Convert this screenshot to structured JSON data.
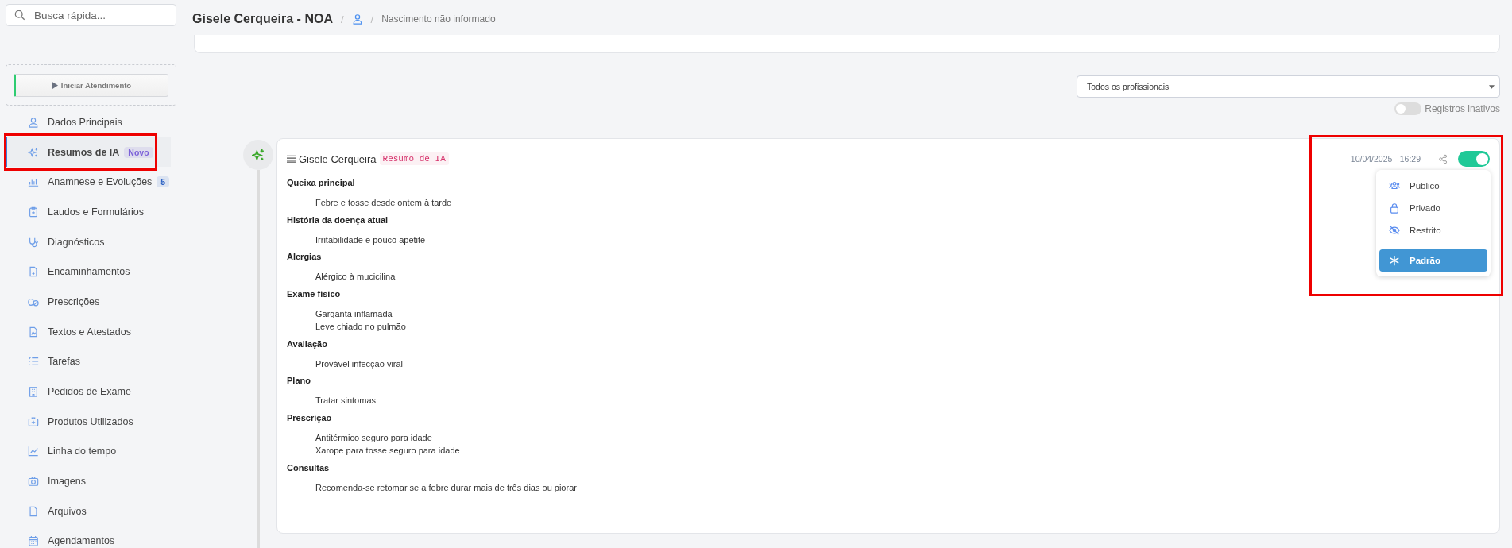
{
  "search": {
    "placeholder": "Busca rápida..."
  },
  "start_button": {
    "label": "Iniciar Atendimento"
  },
  "sidebar": {
    "items": [
      {
        "label": "Dados Principais",
        "selected": false
      },
      {
        "label": "Resumos de IA",
        "selected": true,
        "badge": "Novo",
        "color": "#7b61d8"
      },
      {
        "label": "Anamnese e Evoluções",
        "selected": false,
        "badge": "5",
        "color": "#2c62c4"
      },
      {
        "label": "Laudos e Formulários",
        "selected": false
      },
      {
        "label": "Diagnósticos",
        "selected": false
      },
      {
        "label": "Encaminhamentos",
        "selected": false
      },
      {
        "label": "Prescrições",
        "selected": false
      },
      {
        "label": "Textos e Atestados",
        "selected": false
      },
      {
        "label": "Tarefas",
        "selected": false
      },
      {
        "label": "Pedidos de Exame",
        "selected": false
      },
      {
        "label": "Produtos Utilizados",
        "selected": false
      },
      {
        "label": "Linha do tempo",
        "selected": false
      },
      {
        "label": "Imagens",
        "selected": false
      },
      {
        "label": "Arquivos",
        "selected": false
      },
      {
        "label": "Agendamentos",
        "selected": false
      }
    ]
  },
  "header": {
    "title": "Gisele Cerqueira - NOA",
    "separators": [
      "/",
      "/"
    ],
    "birth": "Nascimento não informado"
  },
  "filter": {
    "value": "Todos os profissionais"
  },
  "inactive_toggle": {
    "label": "Registros inativos",
    "on": false
  },
  "record": {
    "author": "Gisele Cerqueira",
    "tag": "Resumo de IA",
    "date": "10/04/2025 - 16:29",
    "active": true,
    "sections": [
      {
        "heading": "Queixa principal",
        "lines": [
          "Febre e tosse desde ontem à tarde"
        ]
      },
      {
        "heading": "História da doença atual",
        "lines": [
          "Irritabilidade e pouco apetite"
        ]
      },
      {
        "heading": "Alergias",
        "lines": [
          "Alérgico à mucicilina"
        ]
      },
      {
        "heading": "Exame físico",
        "lines": [
          "Garganta inflamada",
          "Leve chiado no pulmão"
        ]
      },
      {
        "heading": "Avaliação",
        "lines": [
          "Provável infecção viral"
        ]
      },
      {
        "heading": "Plano",
        "lines": [
          "Tratar sintomas"
        ]
      },
      {
        "heading": "Prescrição",
        "lines": [
          "Antitérmico seguro para idade",
          "Xarope para tosse seguro para idade"
        ]
      },
      {
        "heading": "Consultas",
        "lines": [
          "Recomenda-se retomar se a febre durar mais de três dias ou piorar"
        ]
      }
    ],
    "visibility_menu": {
      "options": [
        {
          "label": "Publico",
          "selected": false
        },
        {
          "label": "Privado",
          "selected": false
        },
        {
          "label": "Restrito",
          "selected": false
        },
        {
          "label": "Padrão",
          "selected": true
        }
      ]
    }
  }
}
